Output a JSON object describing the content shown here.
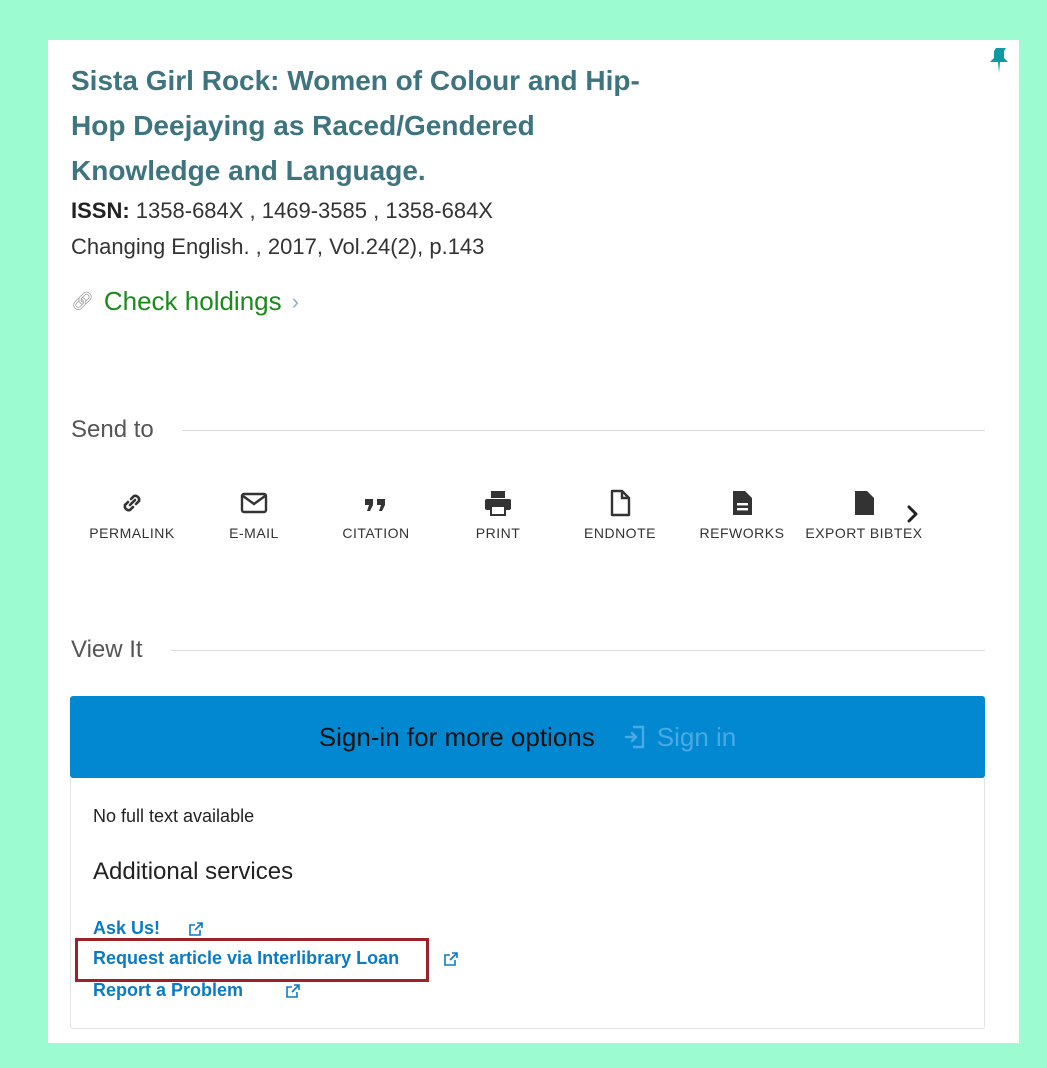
{
  "record": {
    "title_lines": [
      "Sista Girl Rock: Women of Colour and Hip-",
      "Hop Deejaying as Raced/Gendered",
      "Knowledge and Language."
    ],
    "issn_label": "ISSN:",
    "issn_value": " 1358-684X , 1469-3585 , 1358-684X",
    "source": "Changing English. , 2017, Vol.24(2), p.143",
    "check_holdings": "Check holdings"
  },
  "send_to": {
    "heading": "Send to",
    "actions": [
      {
        "label": "PERMALINK",
        "icon": "link-icon"
      },
      {
        "label": "E-MAIL",
        "icon": "mail-icon"
      },
      {
        "label": "CITATION",
        "icon": "quote-icon"
      },
      {
        "label": "PRINT",
        "icon": "printer-icon"
      },
      {
        "label": "ENDNOTE",
        "icon": "file-icon"
      },
      {
        "label": "REFWORKS",
        "icon": "document-icon"
      },
      {
        "label": "EXPORT BIBTEX",
        "icon": "export-icon"
      }
    ]
  },
  "view_it": {
    "heading": "View It",
    "signin_message": "Sign-in for more options",
    "signin_button": "Sign in",
    "no_full_text": "No full text available",
    "additional_services": "Additional services",
    "links": [
      "Ask Us!",
      "Request article via Interlibrary Loan",
      "Report a Problem"
    ]
  },
  "colors": {
    "background": "#9dfbd2",
    "title": "#3d7480",
    "holdings": "#1b8a1b",
    "signin_bar": "#0288d1",
    "link": "#0b7bc4",
    "highlight_box": "#9b2227"
  }
}
